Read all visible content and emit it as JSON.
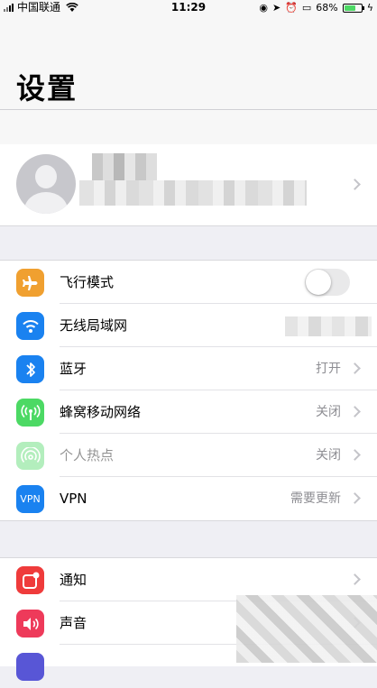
{
  "status_bar": {
    "carrier": "中国联通",
    "time": "11:29",
    "battery": "68%",
    "battery_level": 0.68
  },
  "header": {
    "title": "设置"
  },
  "group1": [
    {
      "label": "飞行模式",
      "icon": "airplane-icon",
      "color": "#f0a030",
      "value": "",
      "control": "toggle",
      "toggle_on": false
    },
    {
      "label": "无线局域网",
      "icon": "wifi-icon",
      "color": "#1a82f0",
      "value": "",
      "control": "blurred"
    },
    {
      "label": "蓝牙",
      "icon": "bluetooth-icon",
      "color": "#1a82f0",
      "value": "打开"
    },
    {
      "label": "蜂窝移动网络",
      "icon": "cellular-icon",
      "color": "#4cd964",
      "value": "关闭"
    },
    {
      "label": "个人热点",
      "icon": "hotspot-icon",
      "color": "#4cd964",
      "value": "关闭",
      "disabled": true
    },
    {
      "label": "VPN",
      "icon": "vpn-icon",
      "icon_text": "VPN",
      "color": "#1a82f0",
      "value": "需要更新"
    }
  ],
  "group2": [
    {
      "label": "通知",
      "icon": "notification-icon",
      "color": "#ef3b3b",
      "value": ""
    },
    {
      "label": "声音",
      "icon": "sound-icon",
      "color": "#ee3a5a",
      "value": ""
    }
  ]
}
